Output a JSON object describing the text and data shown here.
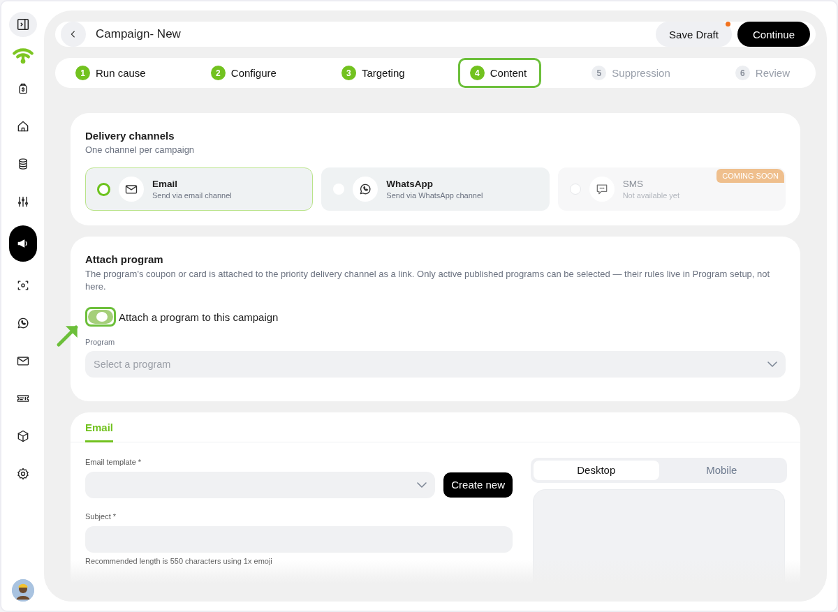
{
  "sidebar": {
    "nav_items": [
      {
        "selected": false
      },
      {
        "selected": false
      },
      {
        "selected": false
      },
      {
        "selected": false
      },
      {
        "selected": true
      },
      {
        "selected": false
      },
      {
        "selected": false
      },
      {
        "selected": false
      },
      {
        "selected": false
      },
      {
        "selected": false
      },
      {
        "selected": false
      }
    ]
  },
  "header": {
    "title": "Campaign- New",
    "buttons": [
      {
        "label": "Save Draft",
        "kind": "secondary",
        "notification_dot": true
      },
      {
        "label": "Continue",
        "kind": "primary",
        "notification_dot": false
      }
    ]
  },
  "steps": [
    {
      "number": "1",
      "label": "Run cause",
      "completed": true,
      "selected": false
    },
    {
      "number": "2",
      "label": "Configure",
      "completed": true,
      "selected": false
    },
    {
      "number": "3",
      "label": "Targeting",
      "completed": true,
      "selected": false
    },
    {
      "number": "4",
      "label": "Content",
      "completed": true,
      "selected": true
    },
    {
      "number": "5",
      "label": "Suppression",
      "completed": false,
      "selected": false
    },
    {
      "number": "6",
      "label": "Review",
      "completed": false,
      "selected": false
    }
  ],
  "delivery_channels": {
    "title": "Delivery channels",
    "subtitle": "One channel per campaign",
    "options": [
      {
        "name": "Email",
        "description": "Send via email channel",
        "selected": true,
        "disabled": false
      },
      {
        "name": "WhatsApp",
        "description": "Send via WhatsApp channel",
        "selected": false,
        "disabled": false
      },
      {
        "name": "SMS",
        "description": "Not available yet",
        "selected": false,
        "disabled": true,
        "badge": "COMING SOON"
      }
    ]
  },
  "attach_program": {
    "title": "Attach program",
    "description": "The program's coupon or card is attached to the priority delivery channel as a link. Only active published programs can be selected — their rules live in Program setup, not here.",
    "toggle": {
      "label": "Attach a program to this campaign",
      "on": true,
      "highlighted": true
    },
    "program_field": {
      "label": "Program",
      "placeholder": "Select a program"
    }
  },
  "email": {
    "tabs": [
      {
        "label": "Email",
        "selected": true
      }
    ],
    "template_label": "Email template *",
    "create_button": "Create new",
    "subject_label": "Subject *",
    "subject_hint": "Recommended length is 550 characters using 1x emoji",
    "preview_tabs": [
      {
        "label": "Desktop",
        "selected": true
      },
      {
        "label": "Mobile",
        "selected": false
      }
    ]
  }
}
